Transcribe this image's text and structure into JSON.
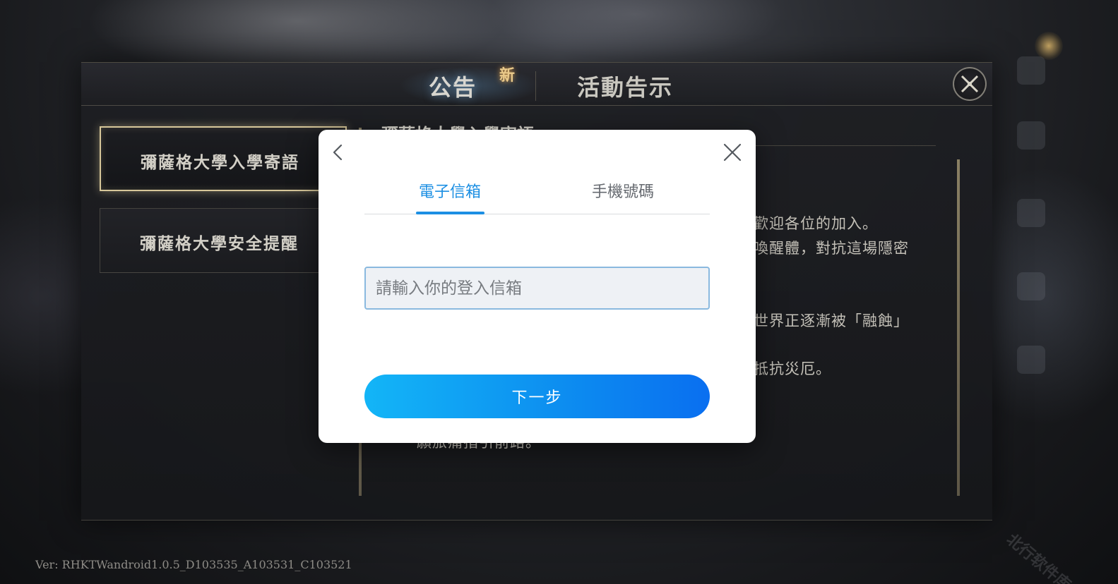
{
  "background": {
    "announce_tab": "公告",
    "new_badge": "新",
    "event_tab": "活動告示",
    "sidebar": [
      {
        "label": "彌薩格大學入學寄語",
        "active": true
      },
      {
        "label": "彌薩格大學安全提醒",
        "active": false
      }
    ],
    "content": {
      "title_partial": "彌薩格大學入學寄語",
      "lines": [
        "歡迎各位的加入。",
        "喚醒體，對抗這場隱密",
        "世界正逐漸被「融蝕」",
        "抵抗災厄。",
        "願旅痛指引前路。"
      ]
    },
    "version": "Ver: RHKTWandroid1.0.5_D103535_A103531_C103521",
    "watermark": "北行软件库"
  },
  "dialog": {
    "tabs": [
      {
        "label": "電子信箱",
        "active": true
      },
      {
        "label": "手機號碼",
        "active": false
      }
    ],
    "email_input": {
      "value": "",
      "placeholder": "請輸入你的登入信箱"
    },
    "next_button": "下一步",
    "colors": {
      "accent": "#1c8fe3",
      "button_start": "#13b5f7",
      "button_end": "#0a6ff0"
    }
  }
}
